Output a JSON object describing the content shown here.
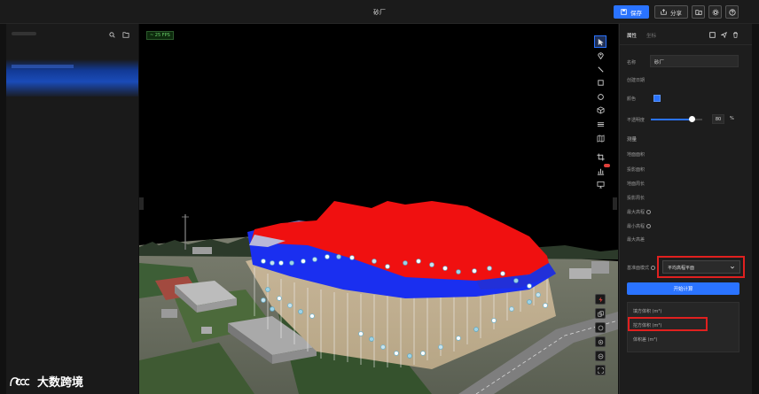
{
  "header": {
    "title": "砂厂",
    "save_label": "保存",
    "share_label": "分享"
  },
  "viewport": {
    "fps_badge": "~ 25 FPS"
  },
  "right_panel": {
    "tabs": [
      {
        "label": "属性"
      },
      {
        "label": "坐标"
      }
    ],
    "name_label": "名称",
    "name_value": "砂厂",
    "created_label": "创建日期",
    "color_label": "颜色",
    "opacity_label": "不透明度",
    "opacity_value": "80",
    "opacity_unit": "%",
    "opacity_level": 0.8,
    "measure_section": "测量",
    "rows": [
      {
        "label": "地面面积"
      },
      {
        "label": "投影面积"
      },
      {
        "label": "地面周长"
      },
      {
        "label": "投影周长"
      },
      {
        "label": "最大高程"
      },
      {
        "label": "最小高程"
      },
      {
        "label": "最大高差"
      }
    ],
    "baseline_label": "基准面模式",
    "baseline_value": "平均高程平面",
    "calc_button": "开始计算",
    "results": [
      {
        "label": "填方体积 (m³)"
      },
      {
        "label": "挖方体积 (m³)"
      },
      {
        "label": "体积差 (m³)"
      }
    ]
  },
  "brand": {
    "name": "大数跨境"
  },
  "colors": {
    "accent": "#2a73ff",
    "highlight": "#e0201f",
    "fill_surface": "#f01010",
    "cut_surface": "#1a2ff0"
  }
}
